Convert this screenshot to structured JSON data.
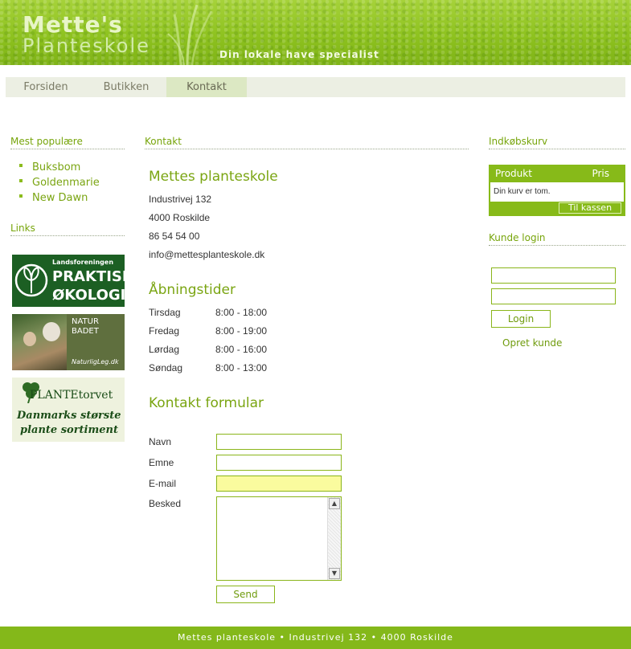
{
  "header": {
    "logo_line1": "Mette's",
    "logo_line2": "Planteskole",
    "tagline": "Din lokale have specialist"
  },
  "nav": {
    "items": [
      {
        "label": "Forsiden"
      },
      {
        "label": "Butikken"
      },
      {
        "label": "Kontakt",
        "active": true
      }
    ]
  },
  "left": {
    "popular_title": "Mest populære",
    "popular": [
      "Buksbom",
      "Goldenmarie",
      "New Dawn"
    ],
    "links_title": "Links",
    "banners": [
      {
        "line1": "Landsforeningen",
        "line2": "PRAKTISK",
        "line3": "ØKOLOGI"
      },
      {
        "line1": "NATUR",
        "line2": "BADET",
        "line3": "NaturligLeg.dk"
      },
      {
        "line1": "PLANTEtorvet",
        "line2": "Danmarks største",
        "line3": "plante sortiment"
      }
    ]
  },
  "main": {
    "section_title": "Kontakt",
    "company": "Mettes planteskole",
    "address": [
      "Industrivej 132",
      "4000 Roskilde",
      "86 54 54 00",
      "info@mettesplanteskole.dk"
    ],
    "hours_title": "Åbningstider",
    "hours": [
      {
        "day": "Tirsdag",
        "time": "8:00 - 18:00"
      },
      {
        "day": "Fredag",
        "time": "8:00 - 19:00"
      },
      {
        "day": "Lørdag",
        "time": "8:00 - 16:00"
      },
      {
        "day": "Søndag",
        "time": "8:00 - 13:00"
      }
    ],
    "form_title": "Kontakt formular",
    "form": {
      "name_label": "Navn",
      "subject_label": "Emne",
      "email_label": "E-mail",
      "message_label": "Besked",
      "send_label": "Send"
    }
  },
  "right": {
    "cart_title": "Indkøbskurv",
    "cart_col_product": "Produkt",
    "cart_col_price": "Pris",
    "cart_empty": "Din kurv er tom.",
    "checkout_label": "Til kassen",
    "login_title": "Kunde login",
    "login_button": "Login",
    "create_customer": "Opret kunde"
  },
  "footer": {
    "text": "Mettes planteskole • Industrivej 132 • 4000 Roskilde"
  }
}
